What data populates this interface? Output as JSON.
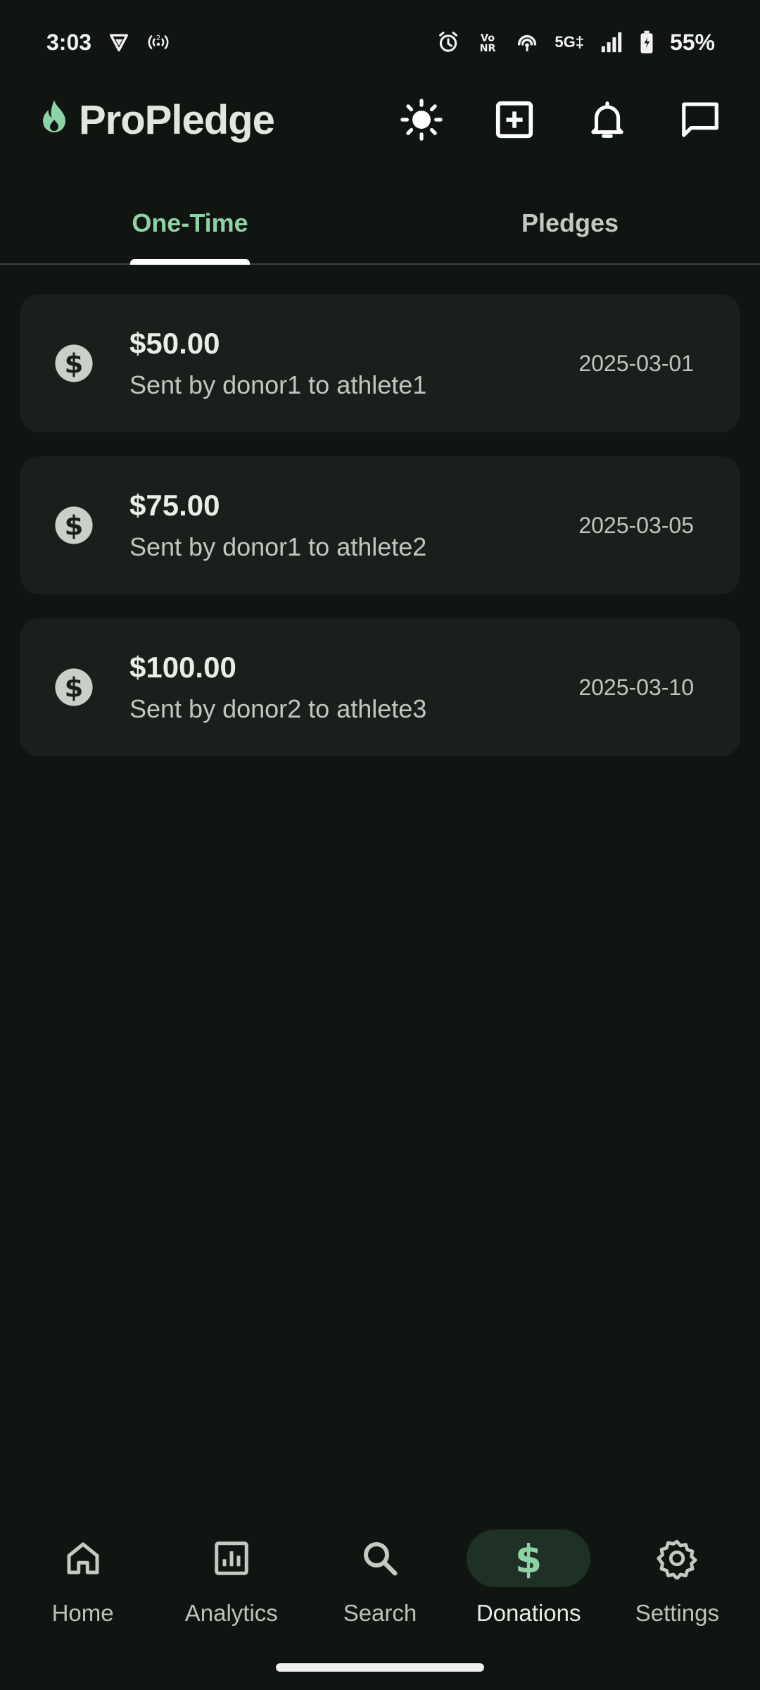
{
  "status_bar": {
    "time": "3:03",
    "network": "5G‡",
    "vonr": "Vo NR",
    "battery": "55%",
    "icons": [
      "vpn-shield-icon",
      "hotspot-icon",
      "alarm-icon",
      "vonr-icon",
      "wifi-calling-icon",
      "signal-icon",
      "battery-icon"
    ]
  },
  "app": {
    "title": "ProPledge",
    "logo_icon": "flame-icon",
    "accent_color": "#8ed3a5",
    "actions": [
      "theme-toggle-icon",
      "add-box-icon",
      "notifications-bell-icon",
      "messages-icon"
    ]
  },
  "tabs": [
    {
      "label": "One-Time",
      "active": true
    },
    {
      "label": "Pledges",
      "active": false
    }
  ],
  "donations": [
    {
      "amount": "$50.00",
      "description": "Sent by donor1 to athlete1",
      "date": "2025-03-01",
      "icon": "dollar-circle-icon"
    },
    {
      "amount": "$75.00",
      "description": "Sent by donor1 to athlete2",
      "date": "2025-03-05",
      "icon": "dollar-circle-icon"
    },
    {
      "amount": "$100.00",
      "description": "Sent by donor2 to athlete3",
      "date": "2025-03-10",
      "icon": "dollar-circle-icon"
    }
  ],
  "bottom_nav": [
    {
      "label": "Home",
      "icon": "home-icon",
      "active": false
    },
    {
      "label": "Analytics",
      "icon": "analytics-icon",
      "active": false
    },
    {
      "label": "Search",
      "icon": "search-icon",
      "active": false
    },
    {
      "label": "Donations",
      "icon": "dollar-icon",
      "active": true
    },
    {
      "label": "Settings",
      "icon": "gear-icon",
      "active": false
    }
  ]
}
